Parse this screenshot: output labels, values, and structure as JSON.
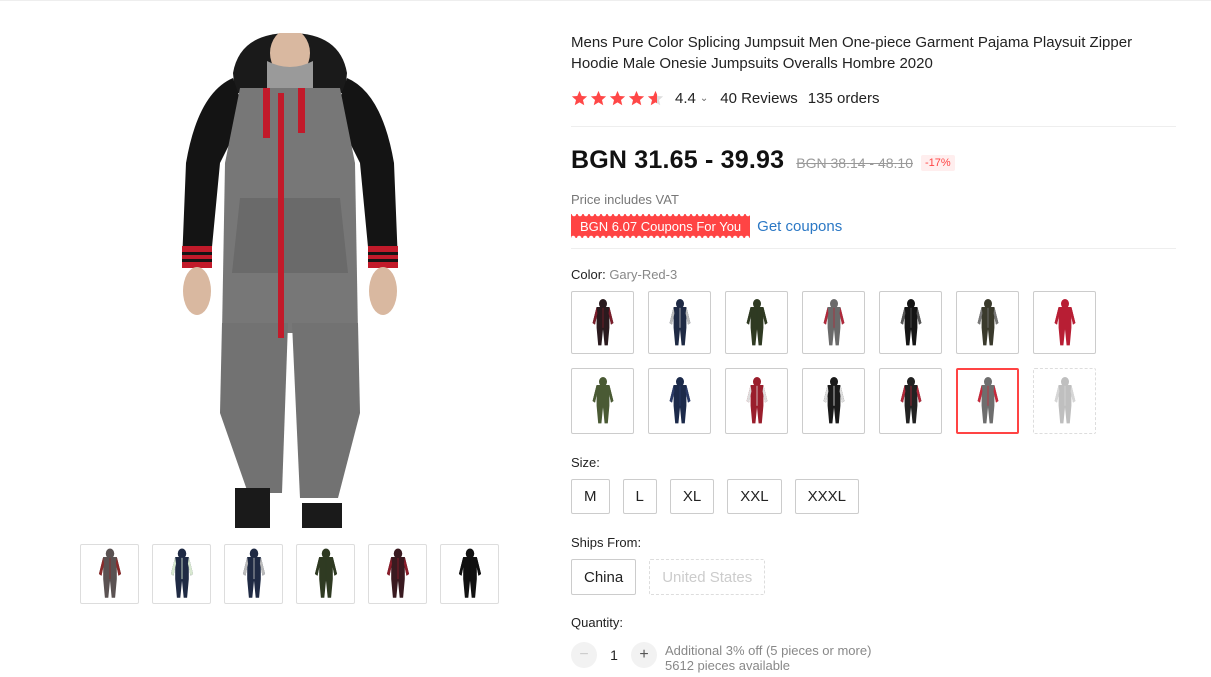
{
  "product": {
    "title": "Mens Pure Color Splicing Jumpsuit Men One-piece Garment Pajama Playsuit Zipper Hoodie Male Onesie Jumpsuits Overalls Hombre 2020",
    "rating": "4.4",
    "reviews": "40 Reviews",
    "orders": "135 orders"
  },
  "price": {
    "current": "BGN 31.65 - 39.93",
    "original": "BGN 38.14 - 48.10",
    "discount": "-17%",
    "vat_note": "Price includes VAT"
  },
  "coupon": {
    "badge": "BGN 6.07 Coupons For You",
    "link": "Get coupons"
  },
  "color": {
    "label": "Color:",
    "selected": "Gary-Red-3",
    "swatches": [
      {
        "body": "#2a1a1e",
        "accent": "#7a1d2a"
      },
      {
        "body": "#1f2a44",
        "accent": "#bbbbbb"
      },
      {
        "body": "#2f3a22",
        "accent": "#2f3a22"
      },
      {
        "body": "#6a6a6a",
        "accent": "#b0283a"
      },
      {
        "body": "#151515",
        "accent": "#555555"
      },
      {
        "body": "#3a3a2c",
        "accent": "#777777"
      },
      {
        "body": "#b81e34",
        "accent": "#b81e34"
      },
      {
        "body": "#4a5a34",
        "accent": "#4a5a34"
      },
      {
        "body": "#1c2a4a",
        "accent": "#2a3a66"
      },
      {
        "body": "#9a1e2c",
        "accent": "#dddddd"
      },
      {
        "body": "#1a1a1a",
        "accent": "#dddddd"
      },
      {
        "body": "#222222",
        "accent": "#b0283a"
      },
      {
        "body": "#6e6e6e",
        "accent": "#c8283a"
      },
      {
        "body": "#bfbfbf",
        "accent": "#d6d6d6"
      }
    ]
  },
  "size": {
    "label": "Size:",
    "options": [
      "M",
      "L",
      "XL",
      "XXL",
      "XXXL"
    ]
  },
  "ships": {
    "label": "Ships From:",
    "options": [
      "China",
      "United States"
    ]
  },
  "quantity": {
    "label": "Quantity:",
    "value": "1",
    "minus": "−",
    "plus": "+",
    "promo": "Additional 3% off (5 pieces or more)",
    "available": "5612 pieces available"
  },
  "colors": {
    "accent": "#ff4747",
    "link": "#2b78c5"
  },
  "thumbnails": [
    {
      "body": "#5a5252",
      "accent": "#8a2a2a"
    },
    {
      "body": "#1f2a44",
      "accent": "#d8e8d0"
    },
    {
      "body": "#1f2a44",
      "accent": "#bbbbbb"
    },
    {
      "body": "#2f3a22",
      "accent": "#2f3a22"
    },
    {
      "body": "#3a1a20",
      "accent": "#8a1d2a"
    },
    {
      "body": "#111111",
      "accent": "#111111"
    }
  ]
}
